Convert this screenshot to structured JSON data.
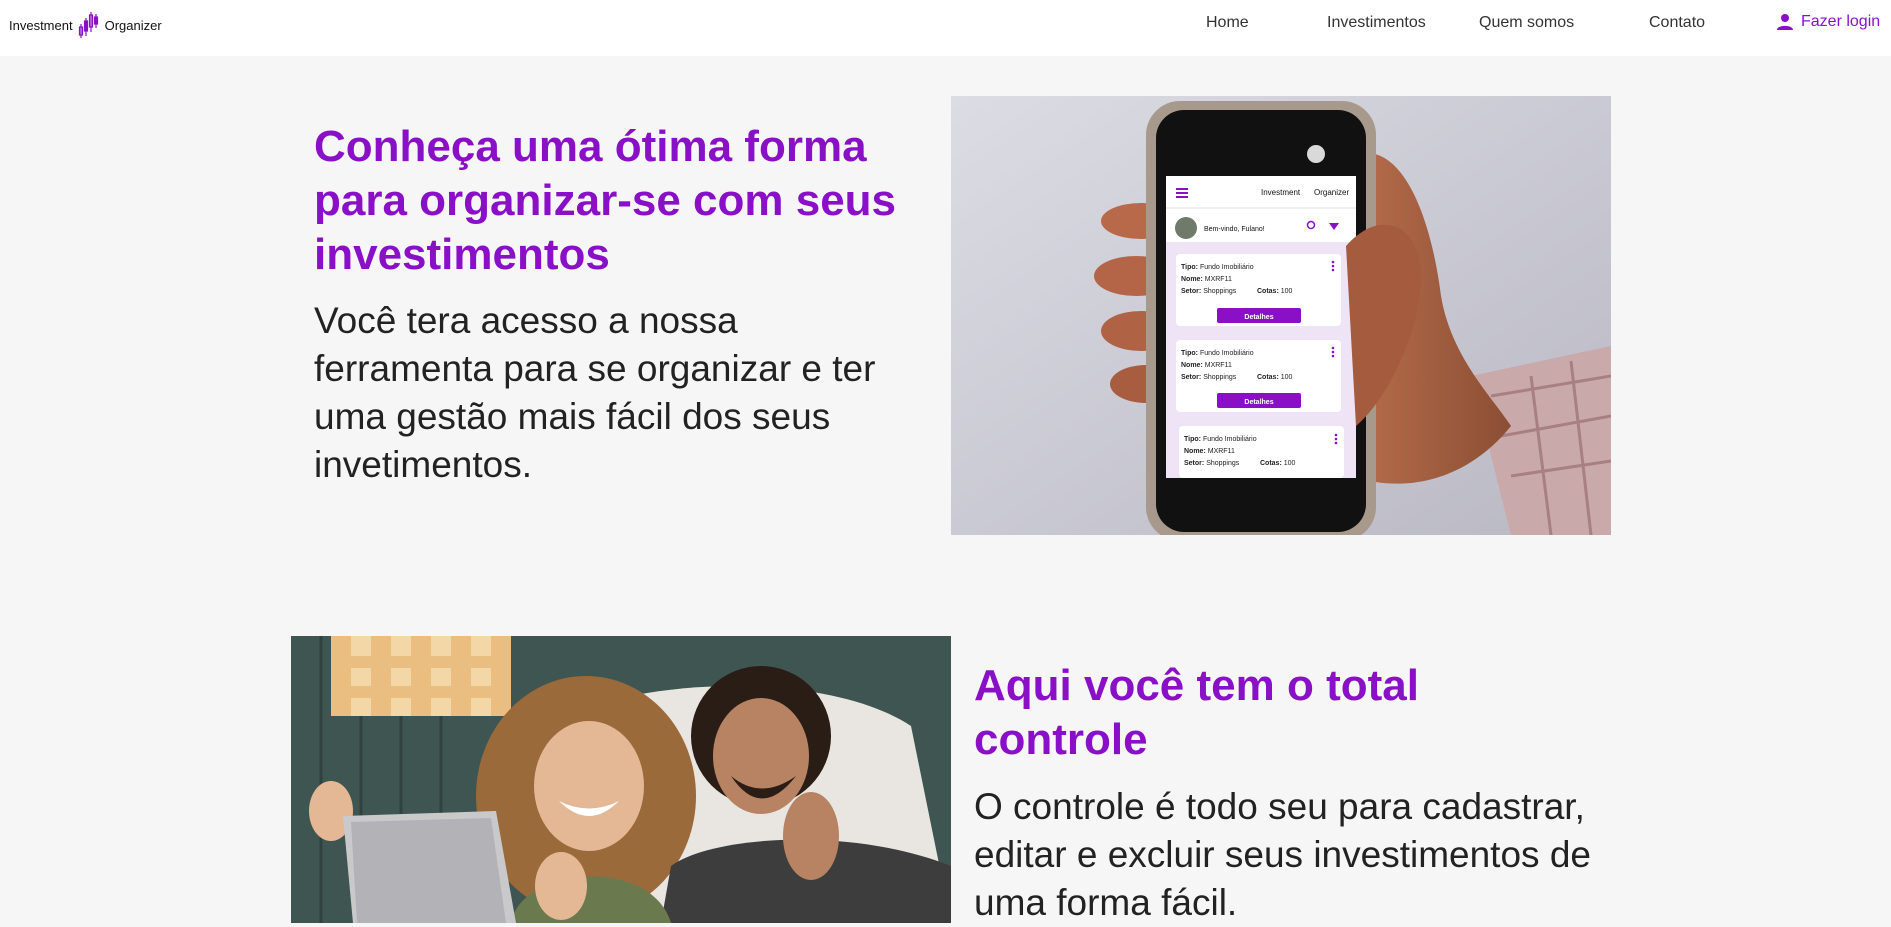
{
  "header": {
    "logo": {
      "left_text": "Investment",
      "right_text": "Organizer",
      "icon": "candlestick-chart-icon"
    },
    "nav": [
      {
        "label": "Home"
      },
      {
        "label": "Investimentos"
      },
      {
        "label": "Quem somos"
      },
      {
        "label": "Contato"
      }
    ],
    "login": {
      "label": "Fazer login",
      "icon": "person-icon"
    }
  },
  "section1": {
    "title": "Conheça uma ótima forma para organizar-se com seus investimentos",
    "text": "Você tera acesso a nossa ferramenta para se organizar e ter uma gestão mais fácil dos seus invetimentos.",
    "image": {
      "subject": "hand holding smartphone",
      "phone": {
        "app_left": "Investment",
        "app_right": "Organizer",
        "greeting": "Bem-vindo, Fulano!",
        "cards": [
          {
            "tipo_label": "Tipo:",
            "tipo": "Fundo Imobiliário",
            "nome_label": "Nome:",
            "nome": "MXRF11",
            "setor_label": "Setor:",
            "setor": "Shoppings",
            "cotas_label": "Cotas:",
            "cotas": "100",
            "button": "Detalhes"
          },
          {
            "tipo_label": "Tipo:",
            "tipo": "Fundo Imobiliário",
            "nome_label": "Nome:",
            "nome": "MXRF11",
            "setor_label": "Setor:",
            "setor": "Shoppings",
            "cotas_label": "Cotas:",
            "cotas": "100",
            "button": "Detalhes"
          },
          {
            "tipo_label": "Tipo:",
            "tipo": "Fundo Imobiliário",
            "nome_label": "Nome:",
            "nome": "MXRF11",
            "setor_label": "Setor:",
            "setor": "Shoppings",
            "cotas_label": "Cotas:",
            "cotas": "100"
          }
        ]
      }
    }
  },
  "section2": {
    "title": "Aqui você tem o total controle",
    "text": "O controle é todo seu para cadastrar, editar e excluir seus investimentos de uma forma fácil.",
    "image": {
      "subject": "couple smiling at laptop"
    }
  },
  "colors": {
    "accent": "#8a10c8",
    "background": "#f7f6f7",
    "header": "#ffffff",
    "text": "#222222"
  }
}
